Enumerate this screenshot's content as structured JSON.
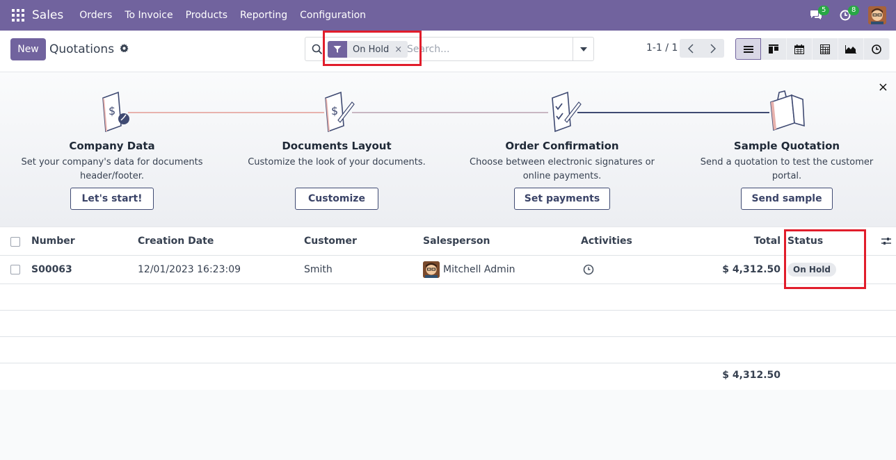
{
  "navbar": {
    "brand": "Sales",
    "menu": [
      "Orders",
      "To Invoice",
      "Products",
      "Reporting",
      "Configuration"
    ],
    "messages_count": "5",
    "activities_count": "8"
  },
  "control": {
    "new_label": "New",
    "breadcrumb": "Quotations",
    "facet_label": "On Hold",
    "facet_remove": "×",
    "search_placeholder": "Search...",
    "pager": "1-1 / 1"
  },
  "onboarding": {
    "close": "×",
    "steps": [
      {
        "title": "Company Data",
        "desc": "Set your company's data for documents header/footer.",
        "button": "Let's start!"
      },
      {
        "title": "Documents Layout",
        "desc": "Customize the look of your documents.",
        "button": "Customize"
      },
      {
        "title": "Order Confirmation",
        "desc": "Choose between electronic signatures or online payments.",
        "button": "Set payments"
      },
      {
        "title": "Sample Quotation",
        "desc": "Send a quotation to test the customer portal.",
        "button": "Send sample"
      }
    ]
  },
  "table": {
    "headers": {
      "number": "Number",
      "creation_date": "Creation Date",
      "customer": "Customer",
      "salesperson": "Salesperson",
      "activities": "Activities",
      "total": "Total",
      "status": "Status"
    },
    "rows": [
      {
        "number": "S00063",
        "creation_date": "12/01/2023 16:23:09",
        "customer": "Smith",
        "salesperson": "Mitchell Admin",
        "total": "$ 4,312.50",
        "status": "On Hold"
      }
    ],
    "grand_total": "$ 4,312.50"
  },
  "colors": {
    "brand": "#71639e",
    "annotation": "#e11d2b"
  }
}
